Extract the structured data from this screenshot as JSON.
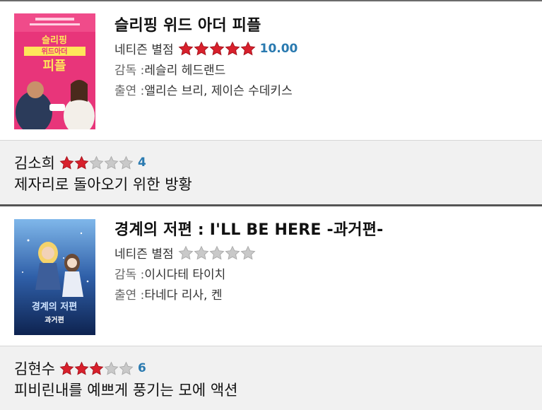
{
  "items": [
    {
      "title": "슬리핑 위드 아더 피플",
      "netizen_label": "네티즌 별점",
      "netizen_stars": 5,
      "netizen_score": "10.00",
      "director_label": "감독 : ",
      "director": "레슬리 헤드랜드",
      "cast_label": "출연 : ",
      "cast": "앨리슨 브리, 제이슨 수데키스",
      "poster": {
        "text_top": "슬리핑",
        "text_mid": "위드아더",
        "text_bottom": "피플",
        "bg": "#e8357a",
        "accent": "#ffe65a"
      },
      "review": {
        "reviewer": "김소희",
        "stars": 2,
        "score": "4",
        "comment": "제자리로 돌아오기 위한 방황"
      }
    },
    {
      "title": "경계의 저편 : I'LL BE HERE -과거편-",
      "netizen_label": "네티즌 별점",
      "netizen_stars": 0,
      "netizen_score": "",
      "director_label": "감독 : ",
      "director": "이시다테 타이치",
      "cast_label": "출연 : ",
      "cast": "타네다 리사, 켄",
      "poster": {
        "text_top": "경계의 저편",
        "text_mid": "과거편",
        "bg": "#2f5fa8",
        "accent": "#cfe4ff"
      },
      "review": {
        "reviewer": "김현수",
        "stars": 3,
        "score": "6",
        "comment": "피비린내를 예쁘게 풍기는 모에 액션"
      }
    }
  ],
  "colors": {
    "star_on": "#d8202c",
    "star_off": "#c9c9c9",
    "score": "#2a7ab0",
    "review_bg": "#f1f1f1",
    "divider": "#555555"
  }
}
